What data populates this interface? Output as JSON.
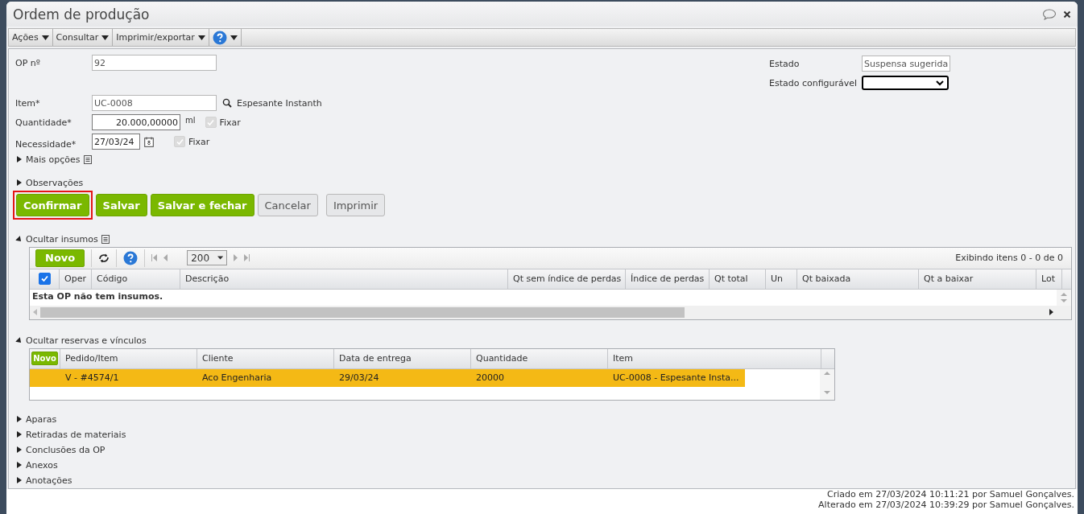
{
  "window": {
    "title": "Ordem de produção"
  },
  "toolbar": [
    {
      "label": "Ações"
    },
    {
      "label": "Consultar"
    },
    {
      "label": "Imprimir/exportar"
    }
  ],
  "form": {
    "op_number": {
      "label": "OP nº",
      "value": "92"
    },
    "estado": {
      "label": "Estado",
      "value": "Suspensa sugerida"
    },
    "estado_configuravel": {
      "label": "Estado configurável"
    },
    "item": {
      "label": "Item*",
      "value": "UC-0008",
      "description": "Espesante Instanth"
    },
    "quantidade": {
      "label": "Quantidade*",
      "value": "20.000,00000",
      "unit": "ml",
      "fixar": {
        "label": "Fixar",
        "checked": true,
        "disabled": true
      }
    },
    "necessidade": {
      "label": "Necessidade*",
      "value": "27/03/24",
      "fixar": {
        "label": "Fixar",
        "checked": true,
        "disabled": true
      }
    }
  },
  "mais_opcoes": {
    "label": "Mais opções",
    "expanded": false
  },
  "observacoes": {
    "label": "Observações",
    "expanded": false
  },
  "buttons": [
    {
      "label": "Confirmar",
      "kind": "primary",
      "highlighted": true
    },
    {
      "label": "Salvar",
      "kind": "primary",
      "highlighted": false
    },
    {
      "label": "Salvar e fechar",
      "kind": "primary",
      "highlighted": false
    },
    {
      "label": "Cancelar",
      "kind": "secondary",
      "highlighted": false
    },
    {
      "label": "Imprimir",
      "kind": "secondary",
      "highlighted": false
    }
  ],
  "insumos": {
    "section": {
      "label": "Ocultar insumos",
      "expanded": true
    },
    "new_button": "Novo",
    "page_size": "200",
    "summary": "Exibindo itens 0 - 0 de 0",
    "select_all_checked": true,
    "columns": [
      "Oper",
      "Código",
      "Descrição",
      "Qt sem índice de perdas",
      "Índice de perdas",
      "Qt total",
      "Un",
      "Qt baixada",
      "Qt a baixar",
      "Lot"
    ],
    "empty_message": "Esta OP não tem insumos."
  },
  "reservas": {
    "section": {
      "label": "Ocultar reservas e vínculos",
      "expanded": true
    },
    "new_button": "Novo",
    "columns": [
      "Pedido/Item",
      "Cliente",
      "Data de entrega",
      "Quantidade",
      "Item"
    ],
    "rows": [
      {
        "cells": [
          "V - #4574/1",
          "Aco Engenharia",
          "29/03/24",
          "20000",
          "UC-0008 - Espesante Insta..."
        ],
        "selected": true
      }
    ]
  },
  "sections": [
    {
      "label": "Aparas",
      "expanded": false
    },
    {
      "label": "Retiradas de materiais",
      "expanded": false
    },
    {
      "label": "Conclusões da OP",
      "expanded": false
    },
    {
      "label": "Anexos",
      "expanded": false
    },
    {
      "label": "Anotações",
      "expanded": false
    }
  ],
  "footer": [
    "Criado em 27/03/2024 10:11:21 por Samuel Gonçalves.",
    "Alterado em 27/03/2024 10:39:29 por Samuel Gonçalves."
  ]
}
